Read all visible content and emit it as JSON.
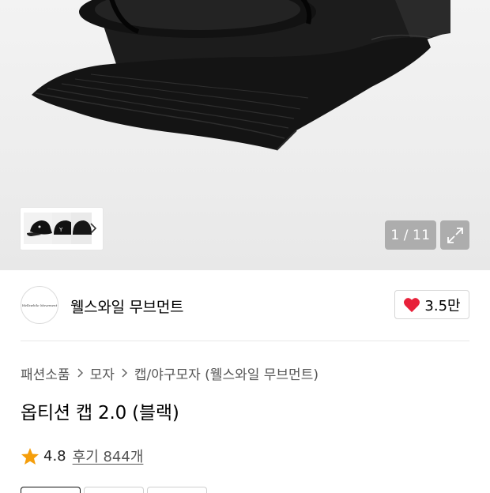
{
  "gallery": {
    "current": "1",
    "separator": "/",
    "total": "11",
    "image_subject": "black baseball cap with sunglasses",
    "thumbnail_count_visible": 3
  },
  "brand": {
    "name": "웰스와일 무브먼트",
    "logo_text": "Wellswhile Movement",
    "like_count": "3.5만"
  },
  "breadcrumb": {
    "items": [
      "패션소품",
      "모자",
      "캡/야구모자 (웰스와일 무브먼트)"
    ]
  },
  "product": {
    "title": "옵티션 캡 2.0 (블랙)"
  },
  "rating": {
    "score": "4.8",
    "reviews_label": "후기 844개"
  },
  "colors": {
    "heart": "#e8213a",
    "star": "#f59e0b",
    "overlay": "#969696"
  },
  "icons": [
    "star-icon",
    "heart-icon",
    "chevron-right-icon",
    "expand-icon"
  ]
}
